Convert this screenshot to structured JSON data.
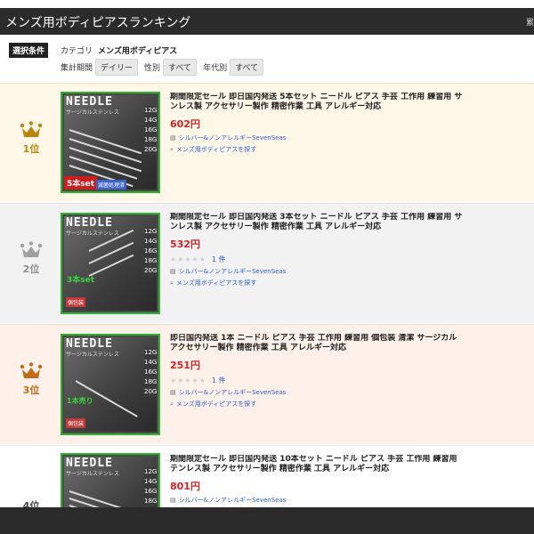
{
  "header": {
    "title": "メンズ用ボディピアスランキング",
    "right_fragment": "累"
  },
  "filters": {
    "selection_badge": "選択条件",
    "category_label": "カテゴリ",
    "category_value": "メンズ用ボディピアス",
    "period_label": "集計期間",
    "period_value": "デイリー",
    "gender_label": "性別",
    "gender_value": "すべて",
    "age_label": "年代別",
    "age_value": "すべて"
  },
  "colors": {
    "gold": "#b8860b",
    "silver": "#a0a0a0",
    "bronze": "#c26a17",
    "price": "#d62222",
    "link": "#2a5bd7",
    "row1_bg": "#fff8e8",
    "row2_bg": "#f2f2f2",
    "row3_bg": "#fdf1ea",
    "row4_bg": "#ffffff"
  },
  "items": [
    {
      "rank": "1位",
      "crown": "gold-crown-icon",
      "name_line1": "期間限定セール 即日国内発送 5本セット ニードル ピアス 手芸 工作用 練習用 サ",
      "name_line2": "ンレス製 アクセサリー製作 精密作業 工具 アレルギー対応",
      "price": "602円",
      "stars": "",
      "review_count": "",
      "shop": "シルバー&ノンアレルギーSevenSeas",
      "search": "メンズ用ボディピアスを探す",
      "thumb_brand": "NEEDLE",
      "thumb_badge": "5本set",
      "thumb_badge2": "滅菌処理済"
    },
    {
      "rank": "2位",
      "crown": "silver-crown-icon",
      "name_line1": "期間限定セール 即日国内発送 3本セット ニードル ピアス 手芸 工作用 練習用 サ",
      "name_line2": "ンレス製 アクセサリー製作 精密作業 工具 アレルギー対応",
      "price": "532円",
      "stars": "★★★★★",
      "review_count": "1 件",
      "shop": "シルバー&ノンアレルギーSevenSeas",
      "search": "メンズ用ボディピアスを探す",
      "thumb_brand": "NEEDLE",
      "thumb_badge": "3本set",
      "thumb_badge2": "個包装"
    },
    {
      "rank": "3位",
      "crown": "bronze-crown-icon",
      "name_line1": "即日国内発送 1本 ニードル ピアス 手芸 工作用 練習用 個包装 清潔 サージカル",
      "name_line2": "アクセサリー製作 精密作業 工具 アレルギー対応",
      "price": "251円",
      "stars": "★★★★★",
      "review_count": "1 件",
      "shop": "シルバー&ノンアレルギーSevenSeas",
      "search": "メンズ用ボディピアスを探す",
      "thumb_brand": "NEEDLE",
      "thumb_badge": "1本売り",
      "thumb_badge2": "個包装"
    },
    {
      "rank": "4位",
      "crown": "",
      "name_line1": "期間限定セール 即日国内発送 10本セット ニードル ピアス 手芸 工作用 練習用",
      "name_line2": "テンレス製 アクセサリー製作 精密作業 工具 アレルギー対応",
      "price": "801円",
      "stars": "",
      "review_count": "",
      "shop": "シルバー&ノンアレルギーSevenSeas",
      "search": "",
      "thumb_brand": "NEEDLE",
      "thumb_badge": "",
      "thumb_badge2": ""
    }
  ],
  "thumb_sizes": [
    "12G",
    "14G",
    "16G",
    "18G",
    "20G"
  ],
  "thumb_subtitle": "サージカルステンレス"
}
